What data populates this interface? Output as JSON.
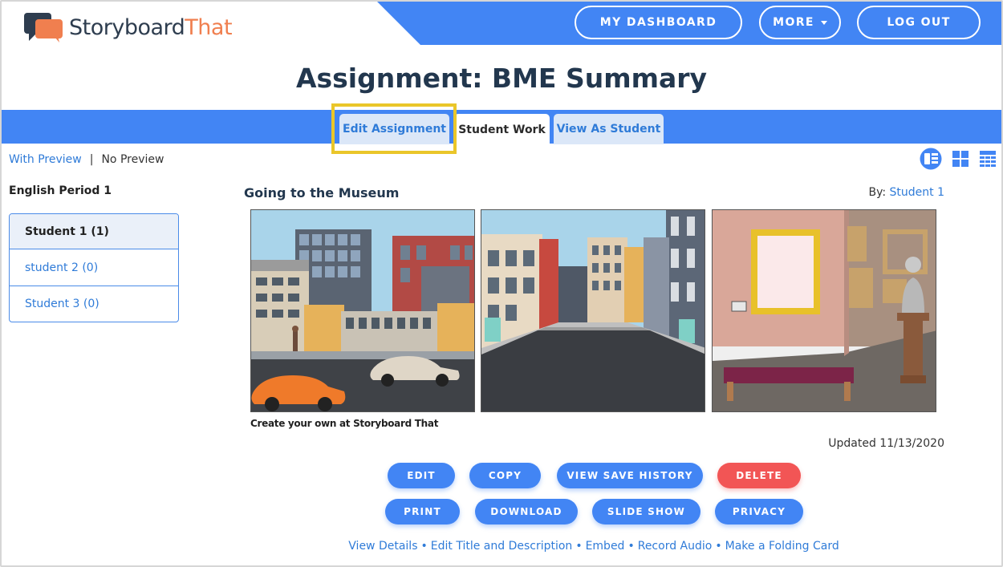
{
  "brand": {
    "name_part1": "Storyboard",
    "name_part2": "That",
    "color_dark": "#2e3d4f",
    "color_accent": "#f07f4f"
  },
  "header": {
    "dashboard_label": "MY DASHBOARD",
    "more_label": "MORE",
    "logout_label": "LOG OUT",
    "bar_color": "#4285f4"
  },
  "page": {
    "title": "Assignment: BME Summary"
  },
  "tabs": [
    {
      "label": "Edit Assignment",
      "highlighted": true
    },
    {
      "label": "Student Work",
      "active": true
    },
    {
      "label": "View As Student"
    }
  ],
  "preview": {
    "with_label": "With Preview",
    "separator": "|",
    "without_label": "No Preview"
  },
  "view_icons": [
    "list-view-icon",
    "grid-view-icon",
    "table-view-icon"
  ],
  "sidebar": {
    "class_name": "English Period 1",
    "students": [
      {
        "label": "Student 1 (1)",
        "selected": true
      },
      {
        "label": "student 2 (0)"
      },
      {
        "label": "Student 3 (0)"
      }
    ]
  },
  "storyboard": {
    "title": "Going to the Museum",
    "by_prefix": "By:",
    "author": "Student 1",
    "credit": "Create your own at Storyboard That",
    "updated": "Updated 11/13/2020",
    "panels": [
      "city-street-with-cars-scene",
      "city-road-buildings-scene",
      "museum-gallery-interior-scene"
    ]
  },
  "actions": {
    "row1": [
      {
        "label": "EDIT"
      },
      {
        "label": "COPY"
      },
      {
        "label": "VIEW SAVE HISTORY"
      },
      {
        "label": "DELETE",
        "danger": true
      }
    ],
    "row2": [
      {
        "label": "PRINT"
      },
      {
        "label": "DOWNLOAD"
      },
      {
        "label": "SLIDE SHOW"
      },
      {
        "label": "PRIVACY"
      }
    ],
    "danger_color": "#f25555"
  },
  "footer_links": [
    "View Details",
    "Edit Title and Description",
    "Embed",
    "Record Audio",
    "Make a Folding Card"
  ]
}
